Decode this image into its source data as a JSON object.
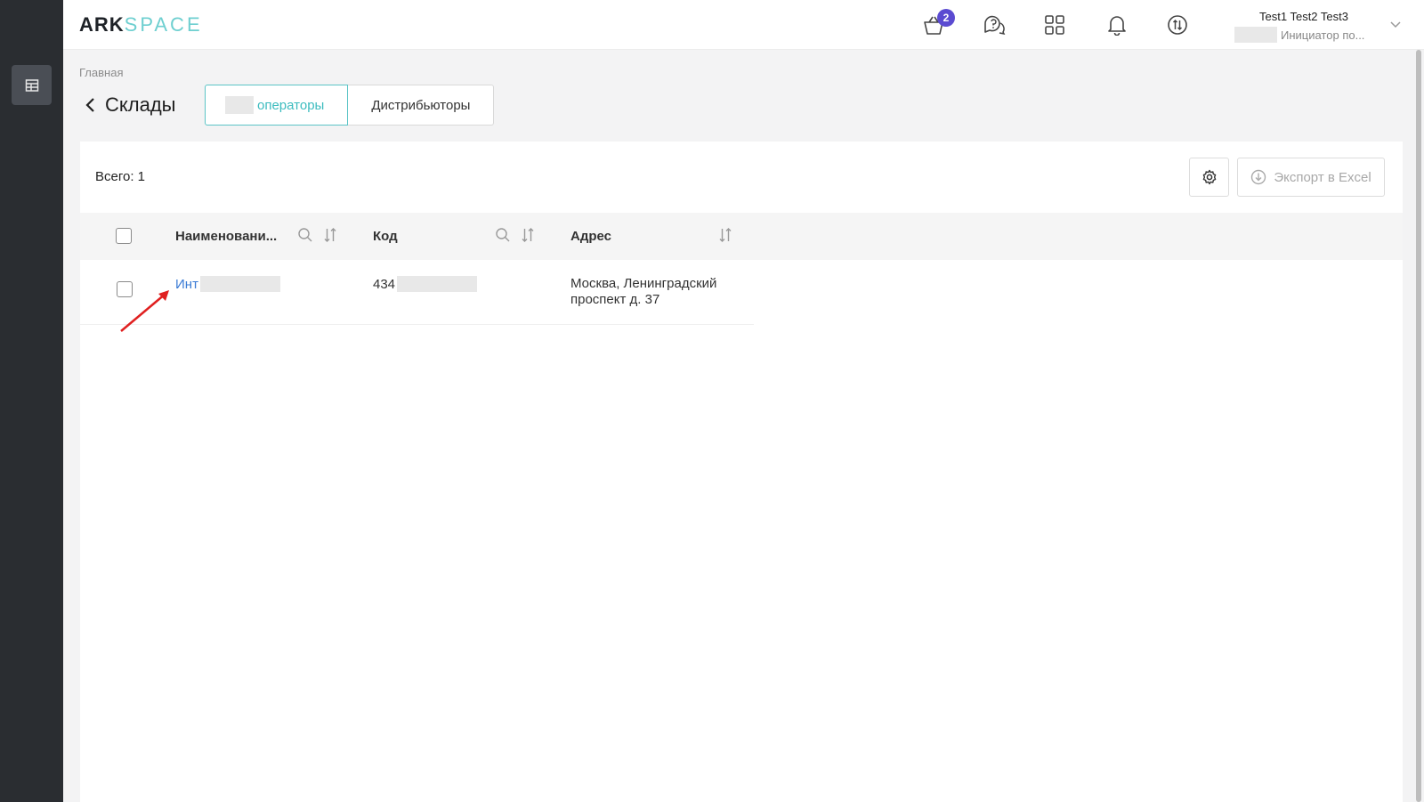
{
  "logo": {
    "ark": "ARK",
    "space": "SPACE"
  },
  "header": {
    "cart_badge": "2",
    "user_name": "Test1 Test2 Test3",
    "user_role": "Инициатор по..."
  },
  "breadcrumb": "Главная",
  "page": {
    "title": "Склады",
    "tabs": [
      {
        "label": "операторы",
        "active": true
      },
      {
        "label": "Дистрибьюторы",
        "active": false
      }
    ]
  },
  "toolbar": {
    "total": "Всего: 1",
    "export_label": "Экспорт в Excel"
  },
  "table": {
    "columns": [
      "Наименовани...",
      "Код",
      "Адрес"
    ],
    "rows": [
      {
        "name": "Инт",
        "code": "434",
        "address_line1": "Москва, Ленинградский",
        "address_line2": "проспект д. 37"
      }
    ]
  },
  "colors": {
    "accent": "#3dbcbf",
    "badge": "#5b4bd1",
    "link": "#3a7bd5",
    "sidebar": "#2a2d31",
    "annotation_arrow": "#e02020"
  }
}
